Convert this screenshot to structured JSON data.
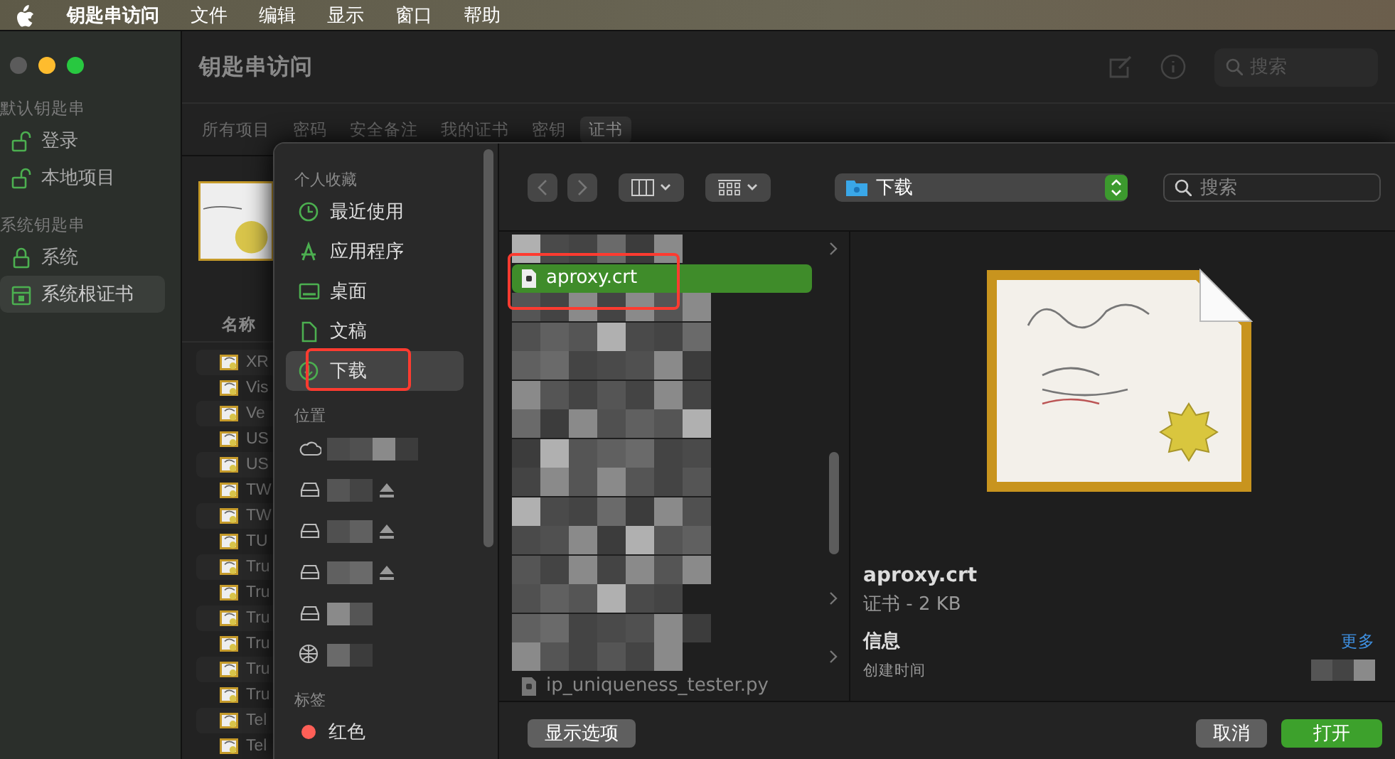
{
  "menubar": {
    "app": "钥匙串访问",
    "menus": [
      "文件",
      "编辑",
      "显示",
      "窗口",
      "帮助"
    ]
  },
  "keychain": {
    "title": "钥匙串访问",
    "search_placeholder": "搜索",
    "sidebar": [
      {
        "heading": "默认钥匙串",
        "items": [
          {
            "label": "登录",
            "kind": "unlock",
            "selected": false
          },
          {
            "label": "本地项目",
            "kind": "unlock",
            "selected": false
          }
        ]
      },
      {
        "heading": "系统钥匙串",
        "items": [
          {
            "label": "系统",
            "kind": "lock",
            "selected": false
          },
          {
            "label": "系统根证书",
            "kind": "cabinet",
            "selected": true
          }
        ]
      }
    ],
    "tabs": [
      {
        "label": "所有项目",
        "selected": false
      },
      {
        "label": "密码",
        "selected": false
      },
      {
        "label": "安全备注",
        "selected": false
      },
      {
        "label": "我的证书",
        "selected": false
      },
      {
        "label": "密钥",
        "selected": false
      },
      {
        "label": "证书",
        "selected": true
      }
    ],
    "column": "名称",
    "rows": [
      "XR",
      "Vis",
      "Ve",
      "US",
      "US",
      "TW",
      "TW",
      "TU",
      "Tru",
      "Tru",
      "Tru",
      "Tru",
      "Tru",
      "Tru",
      "Tel",
      "Tel"
    ]
  },
  "dialog": {
    "sidebar": [
      {
        "heading": "个人收藏",
        "items": [
          {
            "label": "最近使用",
            "kind": "recent",
            "selected": false,
            "highlight": false
          },
          {
            "label": "应用程序",
            "kind": "apps",
            "selected": false,
            "highlight": false
          },
          {
            "label": "桌面",
            "kind": "desktop",
            "selected": false,
            "highlight": false
          },
          {
            "label": "文稿",
            "kind": "docs",
            "selected": false,
            "highlight": false
          },
          {
            "label": "下载",
            "kind": "downloads",
            "selected": true,
            "highlight": true
          }
        ]
      },
      {
        "heading": "位置",
        "items": [
          {
            "kind": "cloud",
            "eject": false
          },
          {
            "kind": "disk",
            "eject": true
          },
          {
            "kind": "disk",
            "eject": true
          },
          {
            "kind": "disk",
            "eject": true
          },
          {
            "kind": "disk",
            "eject": false
          },
          {
            "kind": "network",
            "eject": false
          }
        ]
      },
      {
        "heading": "标签",
        "items": [
          {
            "label": "红色",
            "kind": "tag",
            "color": "#fe5f57"
          }
        ]
      }
    ],
    "location": "下载",
    "search_placeholder": "搜索",
    "files": [
      {
        "kind": "hidden-folder"
      },
      {
        "kind": "file",
        "name": "aproxy.crt",
        "selected": true,
        "highlight": true
      },
      {
        "kind": "hidden-file"
      },
      {
        "kind": "hidden-file"
      },
      {
        "kind": "hidden-file"
      },
      {
        "kind": "hidden-file"
      },
      {
        "kind": "hidden-file"
      },
      {
        "kind": "hidden-file"
      },
      {
        "kind": "hidden-file"
      },
      {
        "kind": "hidden-file"
      },
      {
        "kind": "hidden-file"
      },
      {
        "kind": "hidden-file"
      },
      {
        "kind": "hidden-folder"
      },
      {
        "kind": "hidden-file"
      },
      {
        "kind": "hidden-folder"
      },
      {
        "kind": "file",
        "name": "ip_uniqueness_tester.py",
        "selected": false,
        "highlight": false
      }
    ],
    "preview": {
      "name": "aproxy.crt",
      "info": "证书 - 2 KB",
      "section": "信息",
      "more": "更多",
      "field": "创建时间"
    },
    "buttons": [
      {
        "label": "显示选项",
        "kind": "secondary"
      },
      {
        "label": "取消",
        "kind": "secondary"
      },
      {
        "label": "打开",
        "kind": "primary"
      }
    ]
  }
}
